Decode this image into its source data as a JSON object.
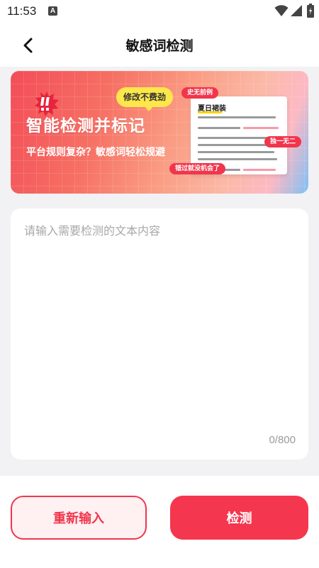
{
  "status_bar": {
    "time": "11:53",
    "notification_letter": "A",
    "icons": [
      "a-notification-icon",
      "wifi-icon",
      "signal-icon",
      "battery-charging-icon"
    ]
  },
  "header": {
    "title": "敏感词检测",
    "back_icon": "chevron-left-icon"
  },
  "banner": {
    "headline": "智能检测并标记",
    "subline": "平台规则复杂？敏感词轻松规避",
    "bubble": "修改不费劲",
    "tag_top": "史无前例",
    "tag_right": "独一无二",
    "tag_bottom": "错过就没机会了",
    "doc_title": "夏日裙装",
    "colors": {
      "banner_start": "#f34d58",
      "banner_end": "#7fc0f5",
      "bubble": "#fde74a",
      "tag": "#f0364d"
    }
  },
  "editor": {
    "placeholder": "请输入需要检测的文本内容",
    "value": "",
    "char_count": "0/800"
  },
  "actions": {
    "reset_label": "重新输入",
    "detect_label": "检测",
    "accent_color": "#f5364f"
  }
}
